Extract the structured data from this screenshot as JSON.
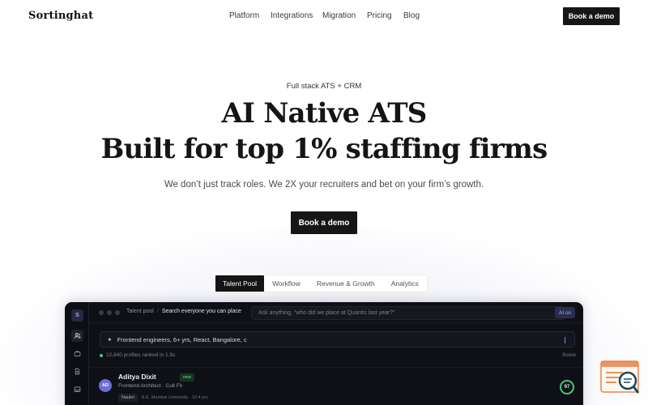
{
  "nav": {
    "logo": "Sortinghat",
    "links": [
      "Platform",
      "Integrations",
      "Migration",
      "Pricing",
      "Blog"
    ],
    "cta": "Book a demo"
  },
  "hero": {
    "eyebrow": "Full stack ATS + CRM",
    "title_line1": "AI Native ATS",
    "title_line2": "Built for top 1% staffing firms",
    "subtitle": "We don’t just track roles. We 2X your recruiters and bet on your firm’s growth.",
    "cta": "Book a demo"
  },
  "tabs": [
    {
      "label": "Talent Pool",
      "active": true
    },
    {
      "label": "Workflow",
      "active": false
    },
    {
      "label": "Revenue & Growth",
      "active": false
    },
    {
      "label": "Analytics",
      "active": false
    }
  ],
  "app": {
    "logo_letter": "S",
    "sidebar_icons": [
      "users-icon",
      "briefcase-icon",
      "document-icon",
      "inbox-icon"
    ],
    "breadcrumb_root": "Talent pool",
    "breadcrumb_current": "Search everyone you can place",
    "ask_placeholder": "Ask anything, “who did we place at Quantis last year?”",
    "ai_badge": "AI on",
    "query": "Frontend engineers, 6+ yrs, React, Bangalore, c",
    "results_meta": "12,840 profiles ranked in 1.9s",
    "score_header": "Score",
    "candidate": {
      "initials": "AD",
      "name": "Aditya Dixit",
      "badge": "new",
      "role": "Frontend Architect · Cult Fit",
      "source_tag": "Naukri",
      "education": "B.E. Mumbai University · 10.4 yrs",
      "score": "97"
    }
  },
  "colors": {
    "accent_dark": "#161616",
    "app_bg": "#0f1015",
    "score_green": "#3ec97a",
    "ai_purple": "#aab0ff",
    "widget_orange": "#e8844a",
    "widget_teal": "#1f4a5a"
  }
}
